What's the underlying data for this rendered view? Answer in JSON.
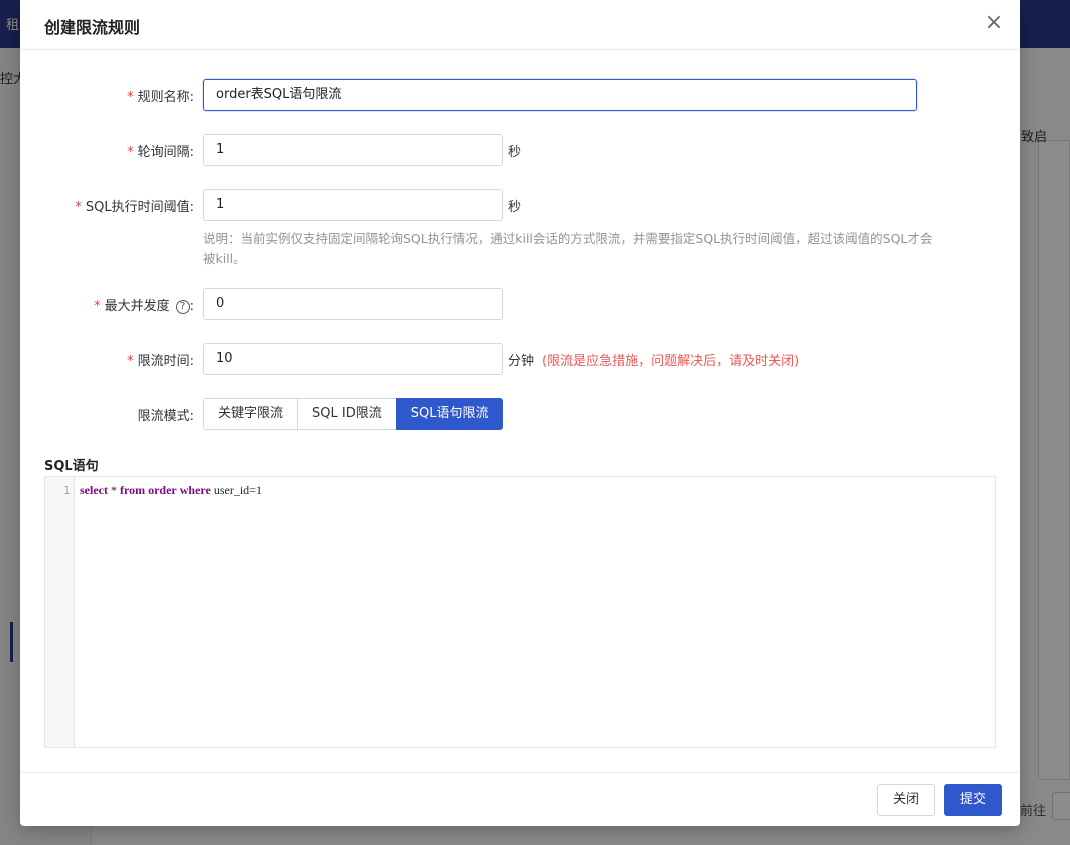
{
  "background": {
    "topbar_text": "租",
    "side_text": "控大",
    "right_label": "致启",
    "goto_label": "前往"
  },
  "dialog": {
    "title": "创建限流规则",
    "close_icon": "×"
  },
  "form": {
    "rule_name": {
      "label": "规则名称:",
      "value": "order表SQL语句限流",
      "required": true
    },
    "poll_interval": {
      "label": "轮询间隔:",
      "value": "1",
      "unit": "秒",
      "required": true
    },
    "exec_threshold": {
      "label": "SQL执行时间阈值:",
      "value": "1",
      "unit": "秒",
      "required": true,
      "description": "说明：当前实例仅支持固定间隔轮询SQL执行情况，通过kill会话的方式限流，并需要指定SQL执行时间阈值，超过该阈值的SQL才会被kill。"
    },
    "max_concurrency": {
      "label": "最大并发度",
      "help_icon": "?",
      "colon": ":",
      "value": "0",
      "required": true
    },
    "limit_time": {
      "label": "限流时间:",
      "value": "10",
      "unit": "分钟",
      "warning": "(限流是应急措施，问题解决后，请及时关闭)",
      "required": true
    },
    "limit_mode": {
      "label": "限流模式:",
      "options": [
        "关键字限流",
        "SQL ID限流",
        "SQL语句限流"
      ],
      "selected": "SQL语句限流"
    }
  },
  "sql_section": {
    "title": "SQL语句",
    "line_number": "1",
    "code": {
      "kw1": "select",
      "t1": " * ",
      "kw2": "from",
      "t2": " ",
      "kw3": "order",
      "t3": " ",
      "kw4": "where",
      "t4": " user_id=1"
    }
  },
  "footer": {
    "close_label": "关闭",
    "submit_label": "提交"
  },
  "colors": {
    "primary": "#2f58cd",
    "warning": "#f05656",
    "required_mark": "#e83e3e"
  }
}
